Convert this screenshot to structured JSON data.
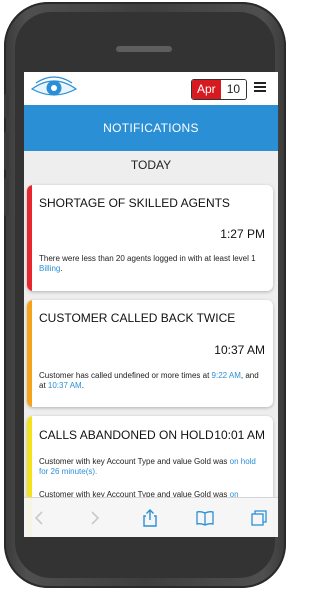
{
  "header": {
    "counter_month": "Apr",
    "counter_value": "10",
    "title": "NOTIFICATIONS"
  },
  "section": {
    "label": "TODAY"
  },
  "notifications": [
    {
      "title": "SHORTAGE OF SKILLED AGENTS",
      "time": "1:27 PM",
      "body_text": "There were less than 20 agents logged in with at least level 1 ",
      "body_link": "Billing",
      "body_end": ".",
      "color": "#e8262d"
    },
    {
      "title": "CUSTOMER CALLED BACK TWICE",
      "time": "10:37 AM",
      "body_text": "Customer has called undefined or more times at ",
      "body_link": "9:22 AM",
      "body_mid": ", and at ",
      "body_link2": "10:37 AM",
      "body_end": ".",
      "color": "#f7a21b"
    },
    {
      "title": "CALLS ABANDONED ON HOLD",
      "time": "10:01 AM",
      "body_text": "Customer with key Account Type and value Gold was ",
      "body_link": "on hold for 26 minute(s).",
      "body2_text": "Customer with key Account Type and value Gold was ",
      "body2_link": "on",
      "color": "#f4e31c"
    }
  ],
  "toolbar": {
    "icons": [
      "back-icon",
      "forward-icon",
      "share-icon",
      "bookmarks-icon",
      "tabs-icon"
    ]
  }
}
